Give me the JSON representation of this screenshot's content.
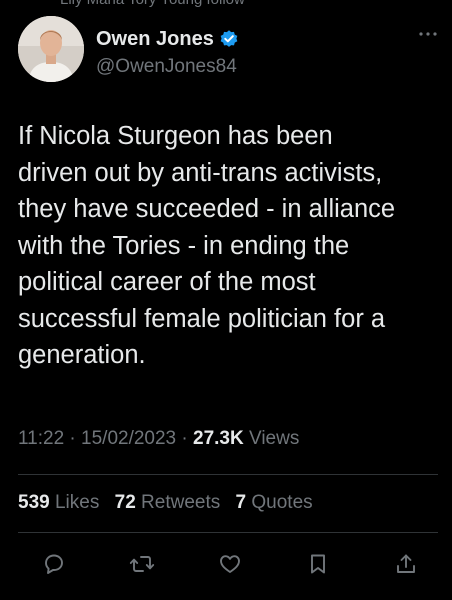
{
  "context": {
    "label": "Lily Maria Tory Young follow"
  },
  "author": {
    "name": "Owen Jones",
    "handle": "@OwenJones84",
    "verified": true
  },
  "tweet": {
    "text": "If Nicola Sturgeon has been\ndriven out by anti-trans activists,\nthey have succeeded - in alliance\nwith the Tories - in ending the\npolitical career of the most\nsuccessful female politician for a\ngeneration."
  },
  "meta": {
    "time": "11:22",
    "separator": "·",
    "date": "15/02/2023",
    "views_count": "27.3K",
    "views_label": "Views"
  },
  "stats": {
    "likes_count": "539",
    "likes_label": "Likes",
    "retweets_count": "72",
    "retweets_label": "Retweets",
    "quotes_count": "7",
    "quotes_label": "Quotes"
  },
  "icons": [
    "reply-icon",
    "retweet-icon",
    "like-icon",
    "bookmark-icon",
    "share-icon",
    "more-icon",
    "verified-badge-icon"
  ],
  "colors": {
    "background": "#000000",
    "text": "#e7e9ea",
    "muted": "#71767b",
    "verified": "#1d9bf0",
    "divider": "#2f3336"
  }
}
